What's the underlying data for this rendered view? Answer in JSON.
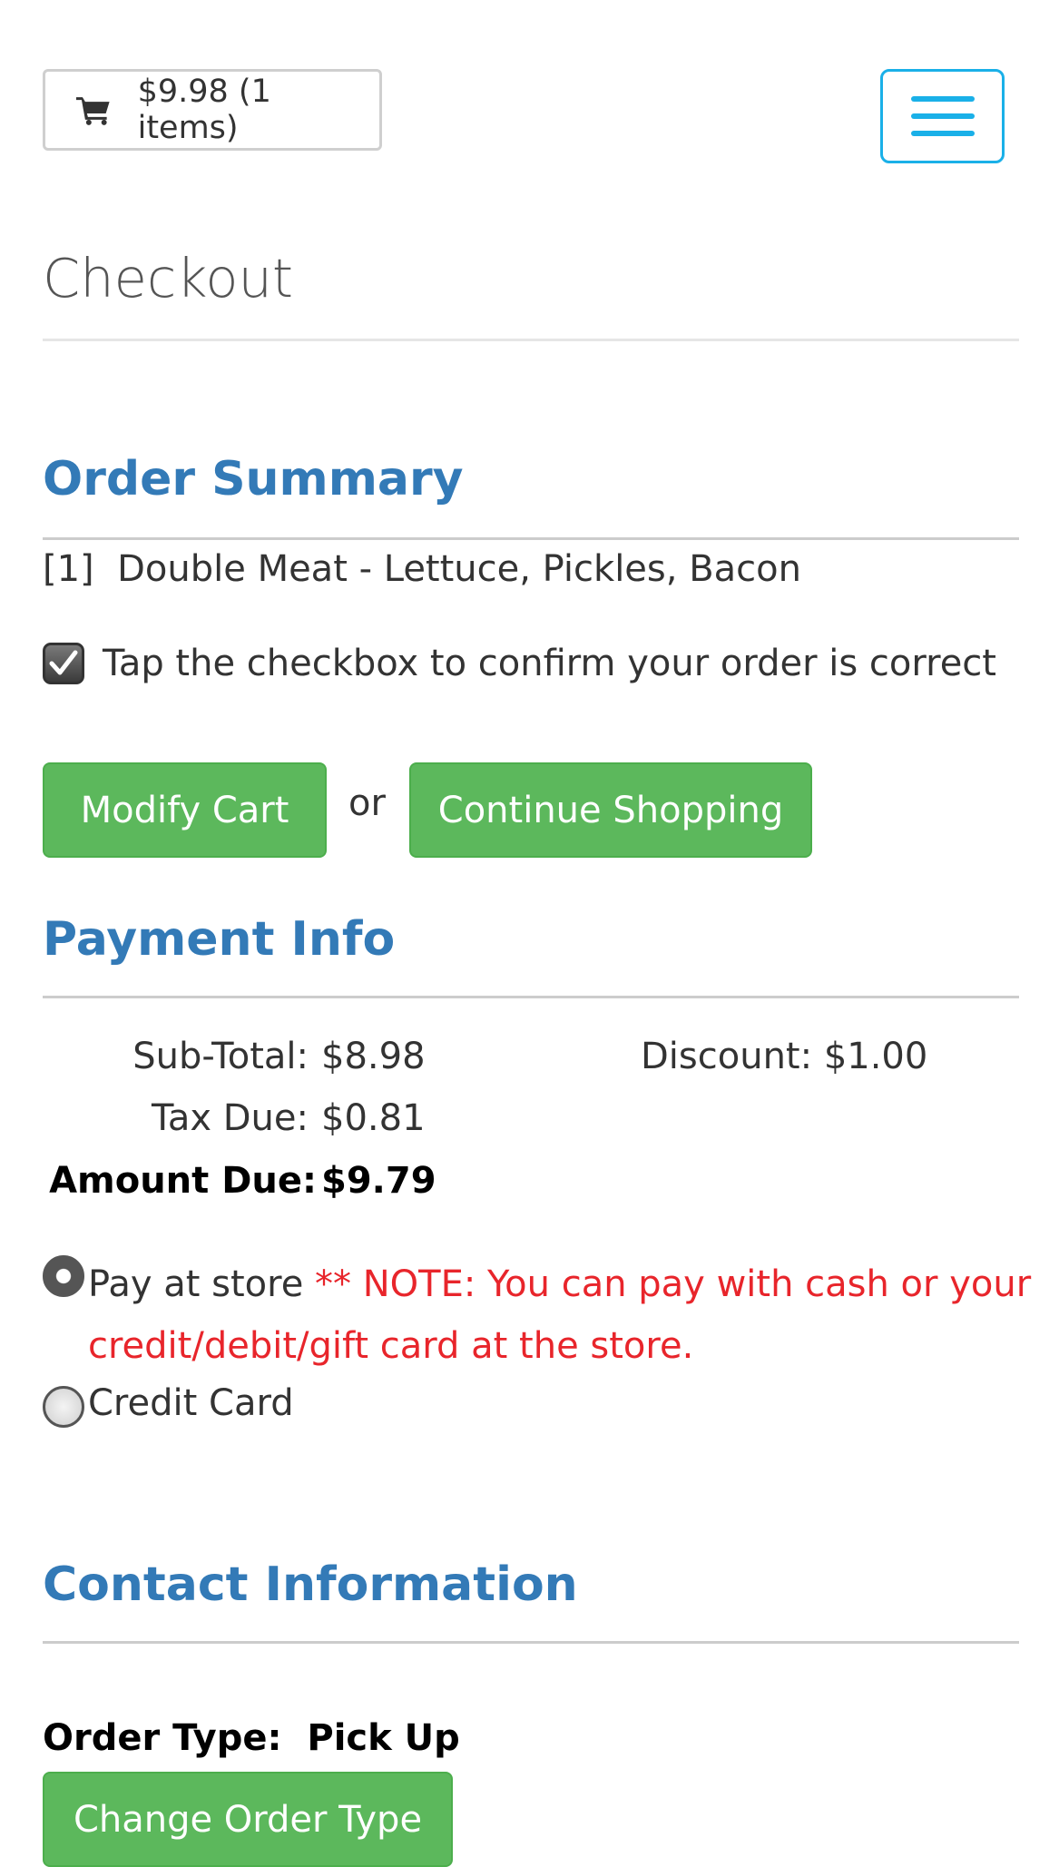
{
  "header": {
    "cart_summary": "$9.98 (1 items)",
    "cart_icon": "shopping-cart-icon",
    "menu_icon": "hamburger-menu-icon"
  },
  "page": {
    "title": "Checkout"
  },
  "order_summary": {
    "heading": "Order Summary",
    "items": [
      {
        "quantity": "[1]",
        "description": "Double Meat - Lettuce, Pickles, Bacon"
      }
    ],
    "confirm_label": "Tap the checkbox to confirm your order is correct",
    "confirm_checked": true,
    "modify_button": "Modify Cart",
    "or_text": "or",
    "continue_button": "Continue Shopping"
  },
  "payment": {
    "heading": "Payment Info",
    "subtotal_label": "Sub-Total:",
    "subtotal_value": "$8.98",
    "discount_label": "Discount:",
    "discount_value": "$1.00",
    "tax_label": "Tax Due:",
    "tax_value": "$0.81",
    "amount_label": "Amount Due:",
    "amount_value": "$9.79",
    "options": [
      {
        "label": "Pay at store",
        "note_line1": "** NOTE: You can pay with cash or your",
        "note_line2": "credit/debit/gift card at the store.",
        "selected": true
      },
      {
        "label": "Credit Card",
        "selected": false
      }
    ]
  },
  "contact": {
    "heading": "Contact Information",
    "order_type_label": "Order Type:",
    "order_type_value": "Pick Up",
    "change_button": "Change Order Type"
  },
  "colors": {
    "accent": "#337ab7",
    "button_green": "#5cb85c",
    "note_red": "#e8252b",
    "menu_border": "#1ab0e8"
  }
}
